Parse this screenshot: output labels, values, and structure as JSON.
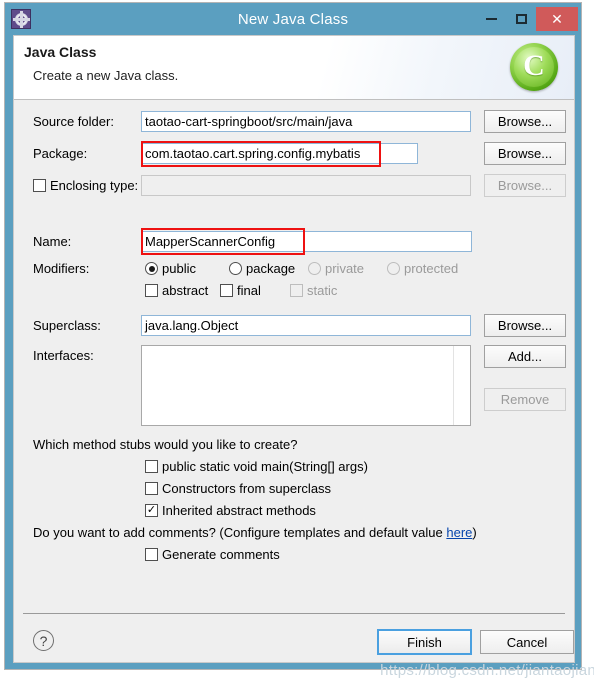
{
  "window": {
    "title": "New Java Class",
    "icon": "gear-icon",
    "controls": {
      "minimize": "–",
      "maximize": "□",
      "close": "✕"
    }
  },
  "header": {
    "title": "Java Class",
    "subtitle": "Create a new Java class.",
    "icon_letter": "C"
  },
  "form": {
    "source_folder": {
      "label": "Source folder:",
      "value": "taotao-cart-springboot/src/main/java",
      "browse": "Browse..."
    },
    "package": {
      "label": "Package:",
      "value": "com.taotao.cart.spring.config.mybatis",
      "browse": "Browse..."
    },
    "enclosing_type": {
      "label": "Enclosing type:",
      "value": "",
      "checked": false,
      "browse": "Browse..."
    },
    "name": {
      "label": "Name:",
      "value": "MapperScannerConfig"
    },
    "modifiers": {
      "label": "Modifiers:",
      "radios": [
        {
          "label": "public",
          "selected": true,
          "enabled": true
        },
        {
          "label": "package",
          "selected": false,
          "enabled": true
        },
        {
          "label": "private",
          "selected": false,
          "enabled": false
        },
        {
          "label": "protected",
          "selected": false,
          "enabled": false
        }
      ],
      "checkboxes": [
        {
          "label": "abstract",
          "checked": false,
          "enabled": true
        },
        {
          "label": "final",
          "checked": false,
          "enabled": true
        },
        {
          "label": "static",
          "checked": false,
          "enabled": false
        }
      ]
    },
    "superclass": {
      "label": "Superclass:",
      "value": "java.lang.Object",
      "browse": "Browse..."
    },
    "interfaces": {
      "label": "Interfaces:",
      "items": [],
      "add": "Add...",
      "remove": "Remove"
    },
    "stubs": {
      "question": "Which method stubs would you like to create?",
      "options": [
        {
          "label": "public static void main(String[] args)",
          "checked": false
        },
        {
          "label": "Constructors from superclass",
          "checked": false
        },
        {
          "label": "Inherited abstract methods",
          "checked": true
        }
      ]
    },
    "comments": {
      "question_prefix": "Do you want to add comments? (Configure templates and default value ",
      "link": "here",
      "question_suffix": ")",
      "option": {
        "label": "Generate comments",
        "checked": false
      }
    }
  },
  "footer": {
    "help": "?",
    "finish": "Finish",
    "cancel": "Cancel"
  },
  "watermark": "https://blog.csdn.net/jiantaojian",
  "colors": {
    "title_bar": "#5b9fc0",
    "close_button": "#d05a5a",
    "annotation": "#ee1111",
    "link": "#0645ad",
    "field_border": "#8fb6d8"
  }
}
